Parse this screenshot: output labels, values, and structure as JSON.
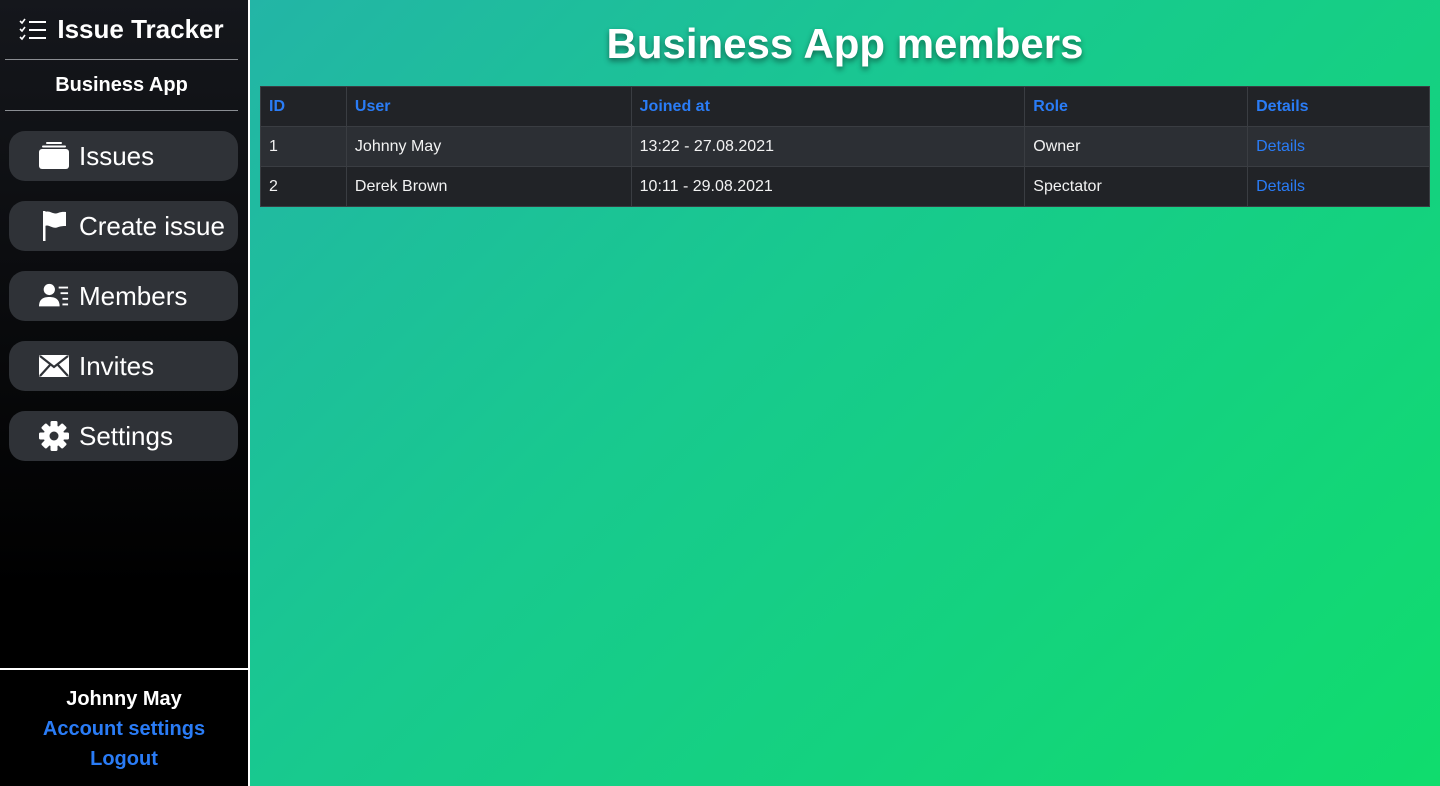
{
  "sidebar": {
    "brand": {
      "title": "Issue Tracker",
      "icon": "checklist-icon"
    },
    "project_name": "Business App",
    "nav": [
      {
        "label": "Issues",
        "icon": "folders-icon"
      },
      {
        "label": "Create issue",
        "icon": "flag-icon"
      },
      {
        "label": "Members",
        "icon": "person-lines-icon"
      },
      {
        "label": "Invites",
        "icon": "envelope-icon"
      },
      {
        "label": "Settings",
        "icon": "gear-icon"
      }
    ],
    "user": {
      "name": "Johnny May",
      "account_settings": "Account settings",
      "logout": "Logout"
    }
  },
  "main": {
    "title": "Business App members",
    "table": {
      "headers": [
        "ID",
        "User",
        "Joined at",
        "Role",
        "Details"
      ],
      "rows": [
        {
          "id": "1",
          "user": "Johnny May",
          "joined_at": "13:22 - 27.08.2021",
          "role": "Owner",
          "details": "Details"
        },
        {
          "id": "2",
          "user": "Derek Brown",
          "joined_at": "10:11 - 29.08.2021",
          "role": "Spectator",
          "details": "Details"
        }
      ]
    }
  },
  "colors": {
    "link": "#2a7cf6",
    "gradient_start": "#23b5a6",
    "gradient_end": "#10dc6d",
    "nav_item_bg": "#2f3237",
    "table_header_bg": "#212327"
  }
}
